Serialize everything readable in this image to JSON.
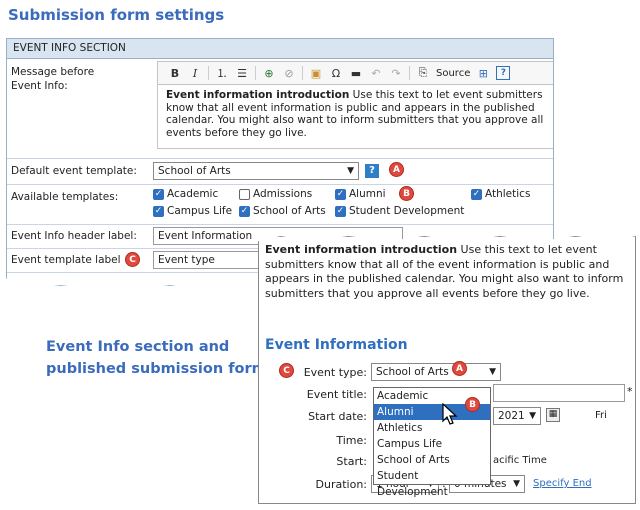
{
  "headings": {
    "settings": "Submission form settings",
    "section_line1": "Event Info section and",
    "section_line2": "published submission form"
  },
  "panel": {
    "section_title": "EVENT INFO SECTION",
    "message_label_1": "Message before",
    "message_label_2": "Event Info:",
    "toolbar": {
      "source_label": "Source"
    },
    "editor_bold": "Event information introduction",
    "editor_text": " Use this text to let event submitters know that all event information is public and appears in the published calendar. You might also want to inform submitters that you approve all events before they go live.",
    "default_template_label": "Default event template:",
    "default_template_value": "School of Arts",
    "help_label": "?",
    "available_label": "Available templates:",
    "templates": [
      {
        "label": "Academic",
        "checked": true
      },
      {
        "label": "Admissions",
        "checked": false
      },
      {
        "label": "Alumni",
        "checked": true
      },
      {
        "label": "Athletics",
        "checked": true
      },
      {
        "label": "Campus Life",
        "checked": true
      },
      {
        "label": "School of Arts",
        "checked": true
      },
      {
        "label": "Student Development",
        "checked": true
      }
    ],
    "header_label": "Event Info header label:",
    "header_value": "Event Information",
    "template_label_label": "Event template label",
    "template_label_value": "Event type"
  },
  "badges": {
    "a": "A",
    "b": "B",
    "c": "C"
  },
  "form": {
    "intro_bold": "Event information introduction",
    "intro_text": " Use this text to let event submitters know that all of the event information is public and appears in the published calendar. You might also want to inform submitters that you approve all events before they go live.",
    "title": "Event Information",
    "event_type_label": "Event type:",
    "event_type_value": "School of Arts",
    "event_title_label": "Event title:",
    "start_date_label": "Start date:",
    "time_label": "Time:",
    "start_label": "Start:",
    "duration_label": "Duration:",
    "options": [
      "Academic",
      "Alumni",
      "Athletics",
      "Campus Life",
      "School of Arts",
      "Student Development"
    ],
    "selected_option": "Alumni",
    "year_fragment": "2021",
    "day_fragment": "Fri",
    "tz_fragment": "acific Time",
    "duration_hours": "1 hour",
    "duration_minutes": "0 minutes",
    "specify_end": "Specify End",
    "required_mark": "*"
  }
}
